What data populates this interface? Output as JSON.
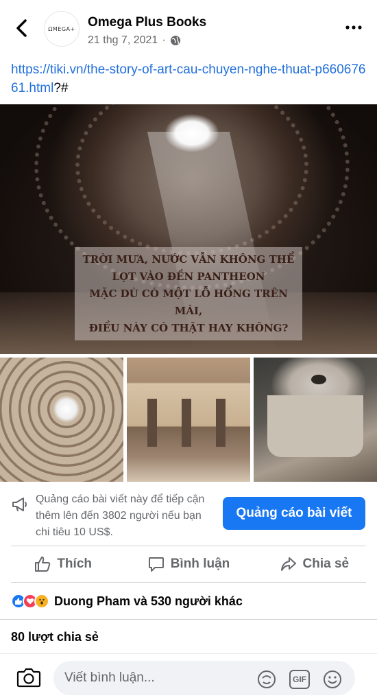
{
  "header": {
    "avatar_text": "ΩMEGA+",
    "page_name": "Omega Plus Books",
    "post_date": "21 thg 7, 2021",
    "audience_icon": "globe-icon",
    "back_icon": "chevron-left-icon",
    "more_icon": "more-horizontal-icon"
  },
  "post": {
    "link_url": "https://tiki.vn/the-story-of-art-cau-chuyen-nghe-thuat-p66067661.html",
    "link_suffix": "?#",
    "image_caption": "TRỜI MƯA, NƯỚC VẪN KHÔNG THỂ\nLỌT VÀO ĐỀN PANTHEON\nMẶC DÙ CÓ MỘT LỖ HỔNG TRÊN MÁI,\nĐIỀU NÀY CÓ THẬT HAY KHÔNG?"
  },
  "promote": {
    "text": "Quảng cáo bài viết này để tiếp cận thêm lên đến 3802 người nếu bạn chi tiêu 10 US$.",
    "button_label": "Quảng cáo bài viết",
    "icon": "megaphone-icon"
  },
  "actions": {
    "like_label": "Thích",
    "comment_label": "Bình luận",
    "share_label": "Chia sẻ"
  },
  "reactions": {
    "types": [
      "like",
      "love",
      "wow"
    ],
    "summary": "Duong Pham và 530 người khác"
  },
  "shares": {
    "count_text": "80 lượt chia sẻ"
  },
  "comment_bar": {
    "placeholder": "Viết bình luận...",
    "gif_label": "GIF"
  },
  "colors": {
    "link": "#216fdb",
    "primary_button": "#1877f2",
    "secondary_text": "#65676b",
    "like": "#1877f2",
    "love": "#f33e58",
    "wow": "#f7b125"
  }
}
